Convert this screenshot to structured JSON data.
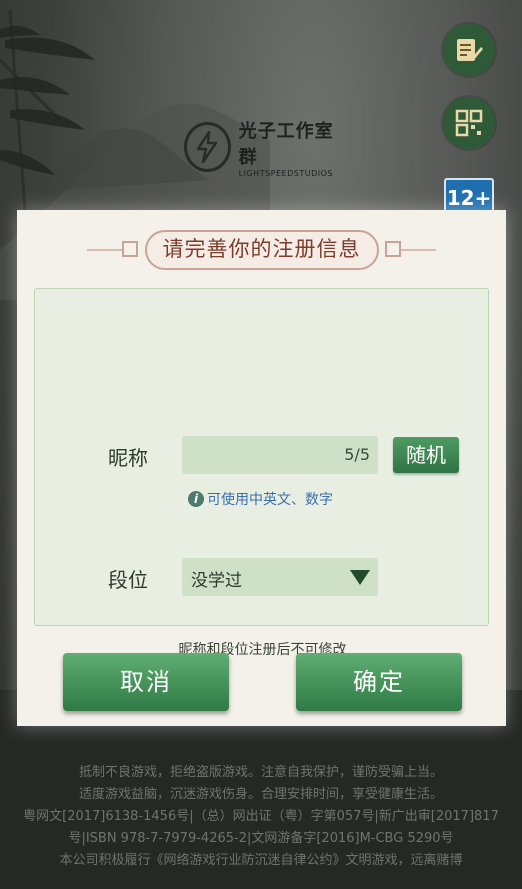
{
  "logo": {
    "name_cn": "光子工作室群",
    "name_en": "LIGHTSPEEDSTUDIOS"
  },
  "side": {
    "notice_icon": "notepad-pen-icon",
    "qr_icon": "qr-code-icon",
    "age_rating": "12+"
  },
  "dialog": {
    "title": "请完善你的注册信息",
    "nickname": {
      "label": "昵称",
      "value": "",
      "count": "5/5",
      "random_button": "随机",
      "hint": "可使用中英文、数字"
    },
    "rank": {
      "label": "段位",
      "selected": "没学过"
    },
    "notice": "昵称和段位注册后不可修改",
    "cancel_button": "取消",
    "confirm_button": "确定"
  },
  "footer": {
    "lines": [
      "抵制不良游戏，拒绝盗版游戏。注意自我保护，谨防受骗上当。",
      "适度游戏益脑，沉迷游戏伤身。合理安排时间，享受健康生活。",
      "粤网文[2017]6138-1456号|（总）网出证（粤）字第057号|新广出审[2017]817号|ISBN 978-7-7979-4265-2|文网游备字[2016]M-CBG 5290号",
      "本公司积极履行《网络游戏行业防沉迷自律公约》文明游戏，远离赌博"
    ]
  },
  "colors": {
    "accent_green": "#2f7344",
    "title_brown": "#7b3e2e",
    "hint_blue": "#3b6fb0"
  }
}
